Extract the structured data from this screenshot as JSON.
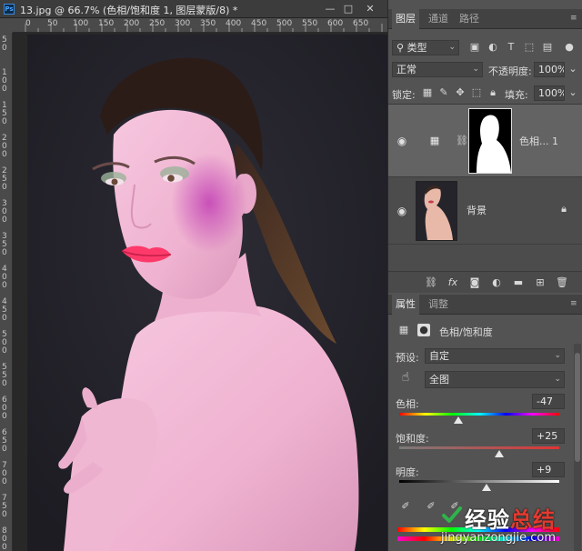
{
  "document": {
    "title": "13.jpg @ 66.7% (色相/饱和度 1, 图层蒙版/8) *",
    "ps_icon": "Ps",
    "window_controls": [
      "—",
      "□",
      "✕"
    ],
    "ruler_h_labels": [
      "0",
      "50",
      "100",
      "150",
      "200",
      "250",
      "300",
      "350",
      "400",
      "450",
      "500",
      "550",
      "600",
      "650"
    ],
    "ruler_v_labels": [
      "5 0",
      "1 0 0",
      "1 5 0",
      "2 0 0",
      "2 5 0",
      "3 0 0",
      "3 5 0",
      "4 0 0",
      "4 5 0",
      "5 0 0",
      "5 5 0",
      "6 0 0",
      "6 5 0",
      "7 0 0",
      "7 5 0",
      "8 0 0"
    ]
  },
  "layers_panel": {
    "tabs": [
      "图层",
      "通道",
      "路径"
    ],
    "active_tab": "图层",
    "filter_kind": "类型",
    "blend_mode": "正常",
    "opacity_label": "不透明度:",
    "opacity_value": "100%",
    "lock_label": "锁定:",
    "fill_label": "填充:",
    "fill_value": "100%",
    "layers": [
      {
        "name": "色相... 1",
        "selected": true
      },
      {
        "name": "背景",
        "selected": false
      }
    ],
    "footer_icons": [
      "link-icon",
      "fx-icon",
      "mask-icon",
      "adjustment-icon",
      "folder-icon",
      "new-layer-icon",
      "trash-icon"
    ],
    "fx_label": "fx"
  },
  "properties_panel": {
    "tabs": [
      "属性",
      "调整"
    ],
    "active_tab": "属性",
    "adjustment_title": "色相/饱和度",
    "preset_label": "预设:",
    "preset_value": "自定",
    "channel_value": "全图",
    "hue_label": "色相:",
    "hue_value": "-47",
    "hue_level": -47,
    "saturation_label": "饱和度:",
    "saturation_value": "+25",
    "saturation_level": 25,
    "lightness_label": "明度:",
    "lightness_value": "+9",
    "lightness_level": 9
  },
  "watermark": {
    "text_white": "经验",
    "text_red": "总结",
    "url": "jingyanzongjie.com"
  },
  "colors": {
    "panel_bg": "#535353",
    "tab_bg": "#424242",
    "canvas_bg": "#23222b",
    "skin": "#f3b9d6",
    "lips": "#ff3a6a",
    "brand_red": "#e43a2f"
  }
}
